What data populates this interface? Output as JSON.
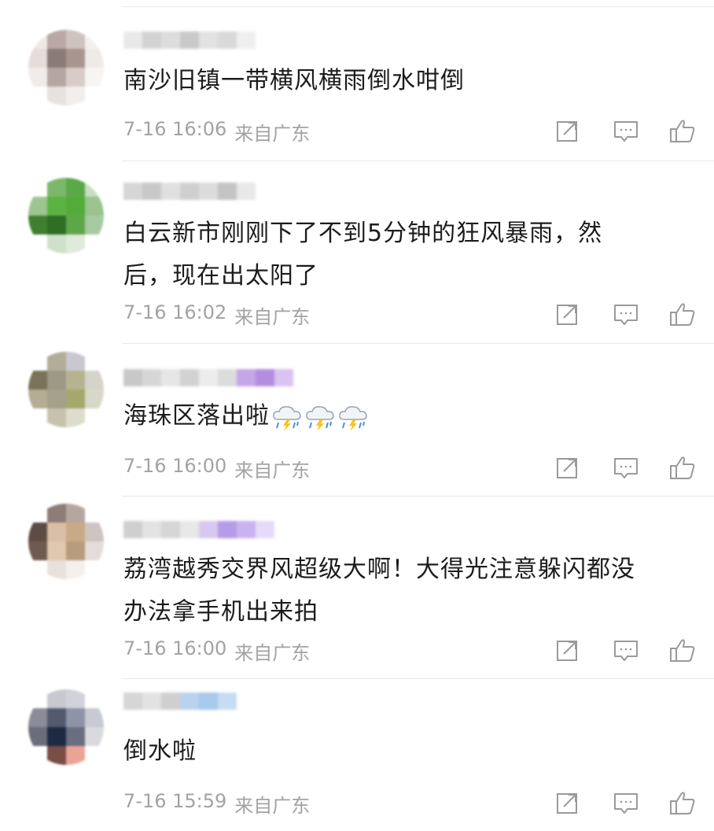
{
  "comments": [
    {
      "text_lines": [
        "南沙旧镇一带横风横雨倒水咁倒"
      ],
      "time": "7-16 16:06",
      "source": "来自广东",
      "avatar_colors": [
        "#efe9e6",
        "#b9a8a4",
        "#cfc3c0",
        "#f3f0ee",
        "#e6ddd9",
        "#8b7b78",
        "#a8958f",
        "#efeae8",
        "#f1ecea",
        "#b5a6a1",
        "#d8ccc8",
        "#f7f4f3",
        "#ffffff",
        "#e8e1de",
        "#f2eeec",
        "#ffffff"
      ],
      "nick_colors": [
        "#e9e9e9",
        "#d3d3d3",
        "#dddddd",
        "#c9c9c9",
        "#e2e2e2",
        "#d9d9d9",
        "#efefef"
      ]
    },
    {
      "text_lines": [
        "白云新市刚刚下了不到5分钟的狂风暴雨，然",
        "后，现在出太阳了"
      ],
      "time": "7-16 16:02",
      "source": "来自广东",
      "avatar_colors": [
        "#ffffff",
        "#7cb86a",
        "#5aa947",
        "#c6dfbf",
        "#9dc58f",
        "#5cb341",
        "#53ac3a",
        "#9ac48b",
        "#3f7f30",
        "#2f6e25",
        "#5ea64a",
        "#a7c9a0",
        "#ffffff",
        "#cfe1ca",
        "#dfe9dc",
        "#ffffff"
      ],
      "nick_colors": [
        "#d6d6d6",
        "#c8c8c8",
        "#e0e0e0",
        "#cfcfcf",
        "#dcdcdc",
        "#c4c4c4",
        "#e8e8e8"
      ]
    },
    {
      "text_lines": [
        "海珠区落出啦"
      ],
      "time": "7-16 16:00",
      "source": "来自广东",
      "emoji_count": 3,
      "emoji_name": "thunderstorm-emoji",
      "avatar_colors": [
        "#ffffff",
        "#b2ad98",
        "#c9c8cf",
        "#ffffff",
        "#7b7359",
        "#9c9a85",
        "#b6b490",
        "#d6d4c9",
        "#b6ab93",
        "#a4a18a",
        "#a5a86c",
        "#d7d8c8",
        "#ffffff",
        "#c7c2ae",
        "#dedccd",
        "#ffffff"
      ],
      "nick_colors": [
        "#c8c8c8",
        "#d6d6d6",
        "#e6e6e6",
        "#d2d2d2",
        "#ececec",
        "#dcdcdc",
        "#c5a6e6",
        "#b48de0",
        "#d9c3f2"
      ]
    },
    {
      "text_lines": [
        "荔湾越秀交界风超级大啊！大得光注意躲闪都没",
        "办法拿手机出来拍"
      ],
      "time": "7-16 16:00",
      "source": "来自广东",
      "avatar_colors": [
        "#ffffff",
        "#8e7d76",
        "#b5a7a0",
        "#ffffff",
        "#5d4b45",
        "#d9bfa3",
        "#c8aa86",
        "#cfc4bf",
        "#70594f",
        "#e0c8ac",
        "#b89d7c",
        "#e3dcd8",
        "#ffffff",
        "#e9e1dc",
        "#f3efec",
        "#ffffff"
      ],
      "nick_colors": [
        "#cfcfcf",
        "#e3e3e3",
        "#d6d6d6",
        "#e8e8e8",
        "#d7c8ef",
        "#b69be6",
        "#c9b3ee",
        "#e6dbf7"
      ]
    },
    {
      "text_lines": [
        "倒水啦"
      ],
      "time": "7-16 15:59",
      "source": "来自广东",
      "avatar_colors": [
        "#ffffff",
        "#c8c9d0",
        "#d2d3da",
        "#ffffff",
        "#8b8c97",
        "#535a70",
        "#8e94a6",
        "#c7c9d3",
        "#6b6d7a",
        "#1e2a44",
        "#6a6e7e",
        "#d9dae0",
        "#ffffff",
        "#7a4d45",
        "#e9a496",
        "#ffffff"
      ],
      "nick_colors": [
        "#d6d6d6",
        "#e2e2e2",
        "#cfcfcf",
        "#b9d2ee",
        "#a8c8ec",
        "#c5dcf3"
      ]
    }
  ],
  "actions": {
    "share_icon": "share-icon",
    "comment_icon": "comment-icon",
    "like_icon": "like-icon"
  },
  "colors": {
    "text": "#1c1c1c",
    "meta": "#a3a3a3",
    "icon": "#9a9a9a",
    "divider": "#e8e8e8"
  }
}
